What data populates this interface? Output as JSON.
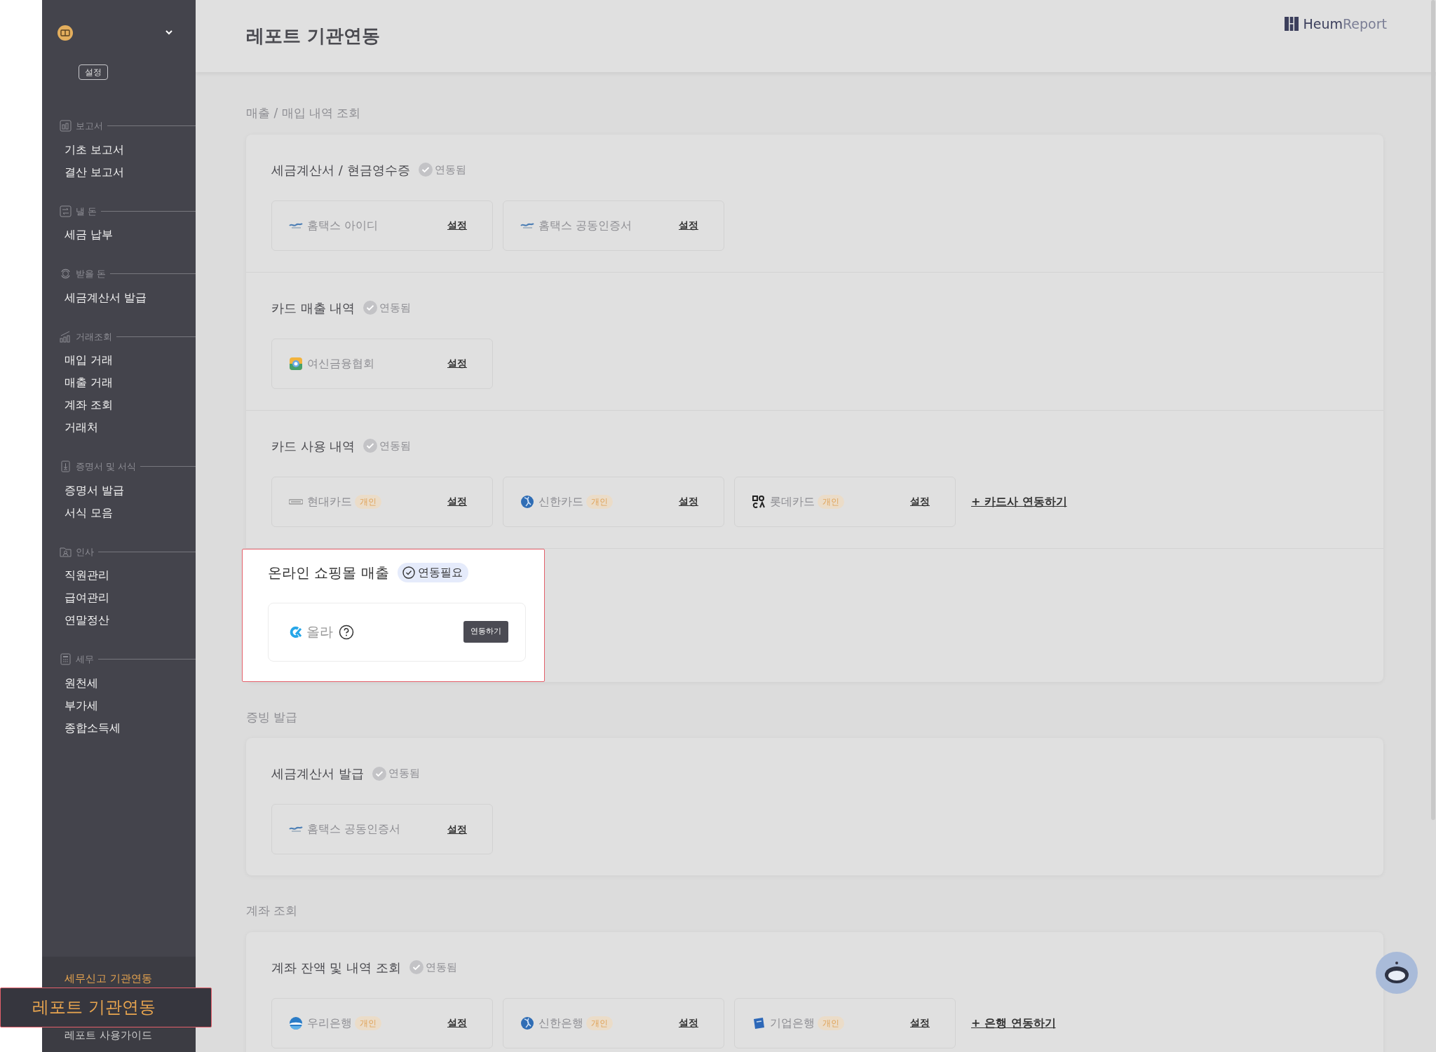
{
  "sidebar": {
    "settings_button": "설정",
    "sections": [
      {
        "title": "보고서",
        "items": [
          "기초 보고서",
          "결산 보고서"
        ]
      },
      {
        "title": "낼 돈",
        "items": [
          "세금 납부"
        ]
      },
      {
        "title": "받을 돈",
        "items": [
          "세금계산서 발급"
        ]
      },
      {
        "title": "거래조회",
        "items": [
          "매입 거래",
          "매출 거래",
          "계좌 조회",
          "거래처"
        ]
      },
      {
        "title": "증명서 및 서식",
        "items": [
          "증명서 발급",
          "서식 모음"
        ]
      },
      {
        "title": "인사",
        "items": [
          "직원관리",
          "급여관리",
          "연말정산"
        ]
      },
      {
        "title": "세무",
        "items": [
          "원천세",
          "부가세",
          "종합소득세"
        ]
      }
    ],
    "footer_links": [
      {
        "label": "세무신고 기관연동",
        "highlighted": false
      },
      {
        "label": "레포트 기관연동",
        "highlighted": true
      },
      {
        "label": "레포트 사용가이드",
        "highlighted": false
      }
    ]
  },
  "header": {
    "title": "레포트 기관연동",
    "logo": {
      "part_1": "Heum",
      "part_2": "Report"
    }
  },
  "sections": [
    {
      "title": "매출 / 매입 내역 조회",
      "groups": [
        {
          "title": "세금계산서 / 현금영수증",
          "status": {
            "kind": "connected",
            "label": "연동됨"
          },
          "highlighted": false,
          "tiles": [
            {
              "name": "홈택스 아이디",
              "kind": "link",
              "action": "설정"
            },
            {
              "name": "홈택스 공동인증서",
              "kind": "link",
              "action": "설정"
            }
          ]
        },
        {
          "title": "카드 매출 내역",
          "status": {
            "kind": "connected",
            "label": "연동됨"
          },
          "highlighted": false,
          "tiles": [
            {
              "name": "여신금융협회",
              "kind": "link",
              "action": "설정"
            }
          ]
        },
        {
          "title": "카드 사용 내역",
          "status": {
            "kind": "connected",
            "label": "연동됨"
          },
          "highlighted": false,
          "tiles": [
            {
              "name": "현대카드",
              "tag": "개인",
              "kind": "link",
              "action": "설정"
            },
            {
              "name": "신한카드",
              "tag": "개인",
              "kind": "link",
              "action": "설정"
            },
            {
              "name": "롯데카드",
              "tag": "개인",
              "kind": "link",
              "action": "설정"
            }
          ],
          "add_link": "+ 카드사 연동하기"
        },
        {
          "title": "온라인 쇼핑몰 매출",
          "status": {
            "kind": "required",
            "label": "연동필요"
          },
          "highlighted": true,
          "tiles": [
            {
              "name": "올라",
              "kind": "button",
              "help": true,
              "action": "연동하기"
            }
          ]
        }
      ]
    },
    {
      "title": "증빙 발급",
      "groups": [
        {
          "title": "세금계산서 발급",
          "status": {
            "kind": "connected",
            "label": "연동됨"
          },
          "highlighted": false,
          "tiles": [
            {
              "name": "홈택스 공동인증서",
              "kind": "link",
              "action": "설정"
            }
          ]
        }
      ]
    },
    {
      "title": "계좌 조회",
      "groups": [
        {
          "title": "계좌 잔액 및 내역 조회",
          "status": {
            "kind": "connected",
            "label": "연동됨"
          },
          "highlighted": false,
          "tiles": [
            {
              "name": "우리은행",
              "tag": "개인",
              "kind": "link",
              "action": "설정"
            },
            {
              "name": "신한은행",
              "tag": "개인",
              "kind": "link",
              "action": "설정"
            },
            {
              "name": "기업은행",
              "tag": "개인",
              "kind": "link",
              "action": "설정"
            }
          ],
          "add_link": "+ 은행 연동하기"
        }
      ]
    }
  ]
}
